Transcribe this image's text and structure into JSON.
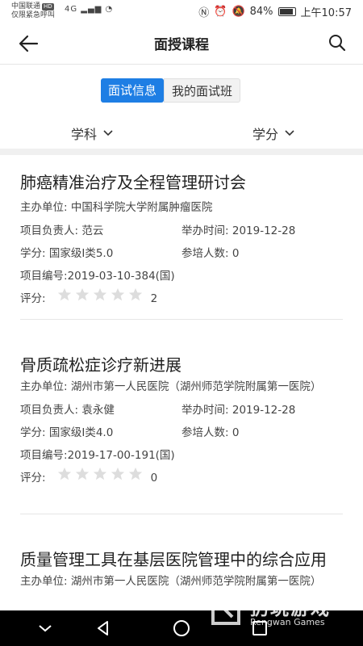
{
  "status_bar": {
    "carrier": "中国联通",
    "carrier_badge": "HD",
    "emergency": "仅限紧急呼叫",
    "signal_text": "4G",
    "battery": "84%",
    "battery_level": 0.84,
    "time": "上午10:57"
  },
  "header": {
    "title": "面授课程"
  },
  "tabs": [
    {
      "label": "面试信息",
      "active": true
    },
    {
      "label": "我的面试班",
      "active": false
    }
  ],
  "filters": [
    {
      "label": "学科"
    },
    {
      "label": "学分"
    }
  ],
  "courses": [
    {
      "title": "肺癌精准治疗及全程管理研讨会",
      "org_label": "主办单位:",
      "org": "中国科学院大学附属肿瘤医院",
      "leader_label": "项目负责人:",
      "leader": "范云",
      "date_label": "举办时间:",
      "date": "2019-12-28",
      "credit_label": "学分:",
      "credit": "国家级I类5.0",
      "attendees_label": "参培人数:",
      "attendees": "0",
      "code_label": "项目编号:",
      "code": "2019-03-10-384(国)",
      "rating_label": "评分:",
      "rating_count": "2",
      "rating": 0
    },
    {
      "title": "骨质疏松症诊疗新进展",
      "org_label": "主办单位:",
      "org": "湖州市第一人民医院（湖州师范学院附属第一医院）",
      "leader_label": "项目负责人:",
      "leader": "袁永健",
      "date_label": "举办时间:",
      "date": "2019-12-28",
      "credit_label": "学分:",
      "credit": "国家级I类4.0",
      "attendees_label": "参培人数:",
      "attendees": "0",
      "code_label": "项目编号:",
      "code": "2019-17-00-191(国)",
      "rating_label": "评分:",
      "rating_count": "0",
      "rating": 0
    },
    {
      "title": "质量管理工具在基层医院管理中的综合应用",
      "org_label": "主办单位:",
      "org": "湖州市第一人民医院（湖州师范学院附属第一医院）"
    }
  ],
  "watermark": {
    "name_cn": "扔玩游戏",
    "name_en": "Rengwan Games"
  },
  "colors": {
    "accent": "#1e7ee4",
    "star_empty": "#dddddd"
  }
}
